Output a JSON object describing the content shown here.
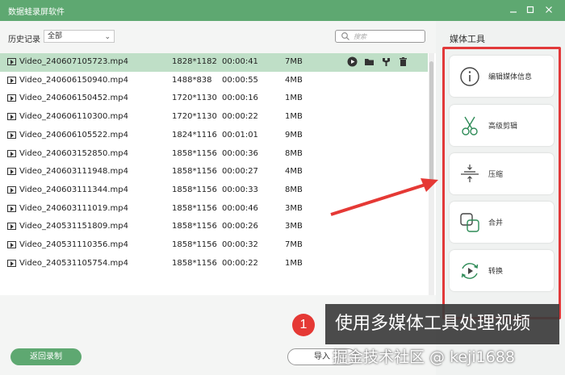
{
  "window": {
    "title": "数据蛙录屏软件",
    "controls": [
      "minimize",
      "maximize",
      "close"
    ]
  },
  "filter": {
    "label": "历史记录",
    "selected": "全部"
  },
  "search": {
    "placeholder": "搜索"
  },
  "files": [
    {
      "name": "Video_240607105723.mp4",
      "resolution": "1828*1182",
      "duration": "00:00:41",
      "size": "7MB",
      "selected": true
    },
    {
      "name": "Video_240606150940.mp4",
      "resolution": "1488*838",
      "duration": "00:00:55",
      "size": "4MB"
    },
    {
      "name": "Video_240606150452.mp4",
      "resolution": "1720*1130",
      "duration": "00:00:16",
      "size": "1MB"
    },
    {
      "name": "Video_240606110300.mp4",
      "resolution": "1720*1130",
      "duration": "00:00:22",
      "size": "1MB"
    },
    {
      "name": "Video_240606105522.mp4",
      "resolution": "1824*1116",
      "duration": "00:01:01",
      "size": "9MB"
    },
    {
      "name": "Video_240603152850.mp4",
      "resolution": "1858*1156",
      "duration": "00:00:36",
      "size": "8MB"
    },
    {
      "name": "Video_240603111948.mp4",
      "resolution": "1858*1156",
      "duration": "00:00:27",
      "size": "4MB"
    },
    {
      "name": "Video_240603111344.mp4",
      "resolution": "1858*1156",
      "duration": "00:00:33",
      "size": "8MB"
    },
    {
      "name": "Video_240603111019.mp4",
      "resolution": "1858*1156",
      "duration": "00:00:46",
      "size": "3MB"
    },
    {
      "name": "Video_240531151809.mp4",
      "resolution": "1858*1156",
      "duration": "00:00:26",
      "size": "3MB"
    },
    {
      "name": "Video_240531110356.mp4",
      "resolution": "1858*1156",
      "duration": "00:00:32",
      "size": "7MB"
    },
    {
      "name": "Video_240531105754.mp4",
      "resolution": "1858*1156",
      "duration": "00:00:22",
      "size": "1MB"
    }
  ],
  "row_actions": [
    "play-icon",
    "folder-icon",
    "edit-tool-icon",
    "trash-icon"
  ],
  "buttons": {
    "back": "返回录制",
    "import": "导入"
  },
  "sidebar": {
    "title": "媒体工具",
    "tools": [
      {
        "label": "编辑媒体信息",
        "icon": "info-icon"
      },
      {
        "label": "高级剪辑",
        "icon": "scissors-icon"
      },
      {
        "label": "压缩",
        "icon": "compress-icon"
      },
      {
        "label": "合并",
        "icon": "merge-icon"
      },
      {
        "label": "转换",
        "icon": "convert-icon"
      }
    ]
  },
  "annotation": {
    "badge": "1",
    "callout": "使用多媒体工具处理视频",
    "watermark": "掘金技术社区 @ keji1688"
  },
  "colors": {
    "accent": "#5ea871",
    "selected_row": "#bfdfc7",
    "highlight": "#e2393a"
  }
}
